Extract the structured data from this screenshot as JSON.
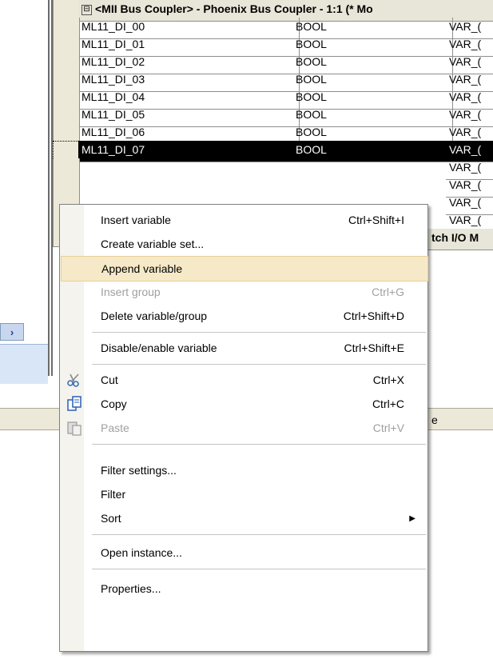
{
  "splitter_button": "›",
  "grid": {
    "group_toggle": "⊟",
    "group_header": "<MII Bus Coupler> - Phoenix Bus Coupler - 1:1 (* Mo",
    "rows": [
      {
        "name": "ML11_DI_00",
        "type": "BOOL",
        "class": "VAR_("
      },
      {
        "name": "ML11_DI_01",
        "type": "BOOL",
        "class": "VAR_("
      },
      {
        "name": "ML11_DI_02",
        "type": "BOOL",
        "class": "VAR_("
      },
      {
        "name": "ML11_DI_03",
        "type": "BOOL",
        "class": "VAR_("
      },
      {
        "name": "ML11_DI_04",
        "type": "BOOL",
        "class": "VAR_("
      },
      {
        "name": "ML11_DI_05",
        "type": "BOOL",
        "class": "VAR_("
      },
      {
        "name": "ML11_DI_06",
        "type": "BOOL",
        "class": "VAR_("
      },
      {
        "name": "ML11_DI_07",
        "type": "BOOL",
        "class": "VAR_("
      }
    ],
    "hidden_rows_col3": [
      "VAR_(",
      "VAR_(",
      "VAR_(",
      "VAR_("
    ],
    "group_footer_fragment": "tch I/O M",
    "statusbar_fragment": "e"
  },
  "context_menu": {
    "items": [
      {
        "label": "Insert variable",
        "shortcut": "Ctrl+Shift+I",
        "disabled": false
      },
      {
        "label": "Create variable set...",
        "shortcut": "",
        "disabled": false
      },
      {
        "label": "Append variable",
        "shortcut": "",
        "disabled": false,
        "highlighted": true
      },
      {
        "label": "Insert group",
        "shortcut": "Ctrl+G",
        "disabled": true
      },
      {
        "label": "Delete variable/group",
        "shortcut": "Ctrl+Shift+D",
        "disabled": false
      },
      {
        "label": "Disable/enable variable",
        "shortcut": "Ctrl+Shift+E",
        "disabled": false
      },
      {
        "label": "Cut",
        "shortcut": "Ctrl+X",
        "disabled": false,
        "icon": "scissors-icon"
      },
      {
        "label": "Copy",
        "shortcut": "Ctrl+C",
        "disabled": false,
        "icon": "copy-icon"
      },
      {
        "label": "Paste",
        "shortcut": "Ctrl+V",
        "disabled": true,
        "icon": "paste-icon"
      },
      {
        "label": "Filter settings...",
        "shortcut": "",
        "disabled": false
      },
      {
        "label": "Filter",
        "shortcut": "",
        "disabled": false
      },
      {
        "label": "Sort",
        "shortcut": "",
        "disabled": false,
        "submenu": true
      },
      {
        "label": "Open instance...",
        "shortcut": "",
        "disabled": false
      },
      {
        "label": "Properties...",
        "shortcut": "",
        "disabled": false
      }
    ],
    "submenu_arrow": "▶"
  },
  "colors": {
    "highlight_bg": "#f6e9c8",
    "selected_row_bg": "#000000",
    "disabled_text": "#a0a0a0"
  }
}
